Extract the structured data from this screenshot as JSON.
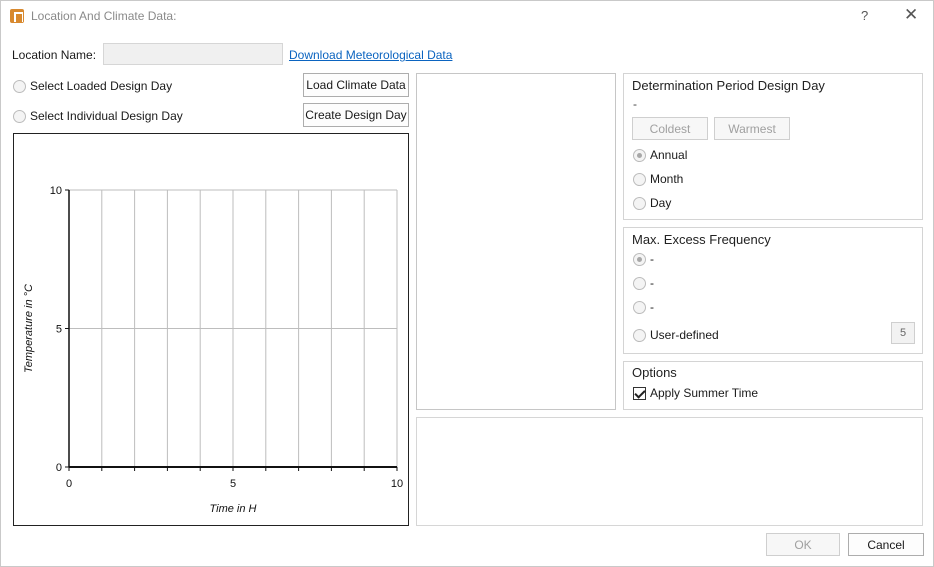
{
  "window": {
    "title": "Location And Climate Data:",
    "help_glyph": "?",
    "close_glyph": "✕"
  },
  "location": {
    "label": "Location Name:",
    "value": "",
    "download_link": "Download Meteorological Data"
  },
  "design_day_source": {
    "options": [
      {
        "label": "Select Loaded Design Day",
        "checked": false
      },
      {
        "label": "Select Individual Design Day",
        "checked": false
      }
    ],
    "load_button": "Load Climate Data",
    "create_button": "Create Design Day"
  },
  "chart_data": {
    "type": "line",
    "xlabel": "Time in H",
    "ylabel": "Temperature in °C",
    "xlim": [
      0,
      10
    ],
    "ylim": [
      0,
      10
    ],
    "x_ticks": [
      0,
      5,
      10
    ],
    "y_ticks": [
      0,
      5,
      10
    ],
    "x_gridlines": [
      0,
      1,
      2,
      3,
      4,
      5,
      6,
      7,
      8,
      9,
      10
    ],
    "y_gridlines": [
      0,
      5,
      10
    ],
    "grid": true,
    "series": []
  },
  "determination": {
    "title": "Determination Period Design Day",
    "value": "-",
    "coldest_button": "Coldest",
    "warmest_button": "Warmest",
    "options": [
      {
        "label": "Annual",
        "checked": true
      },
      {
        "label": "Month",
        "checked": false
      },
      {
        "label": "Day",
        "checked": false
      }
    ]
  },
  "excess_frequency": {
    "title": "Max. Excess Frequency",
    "options": [
      {
        "label": "-",
        "checked": true
      },
      {
        "label": "-",
        "checked": false
      },
      {
        "label": "-",
        "checked": false
      },
      {
        "label": "User-defined",
        "checked": false
      }
    ],
    "user_value": "5"
  },
  "options_group": {
    "title": "Options",
    "apply_summer_time": "Apply Summer Time",
    "apply_summer_time_checked": true
  },
  "footer": {
    "ok": "OK",
    "cancel": "Cancel"
  }
}
